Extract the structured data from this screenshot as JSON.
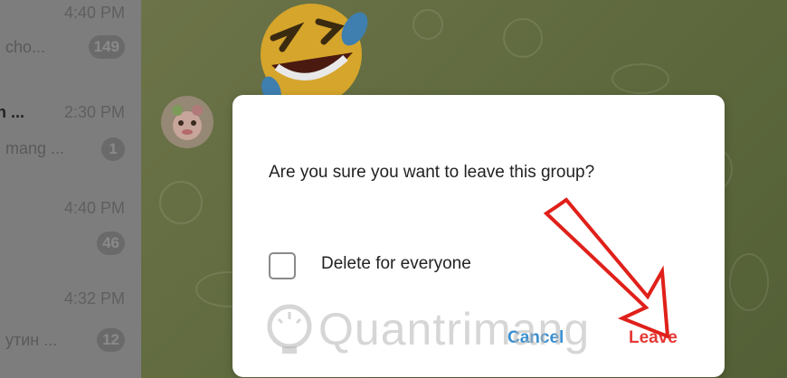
{
  "chat_list": [
    {
      "time": "4:40 PM",
      "name": "",
      "preview": "cho...",
      "badge": "149"
    },
    {
      "time": "2:30 PM",
      "name": "n ...",
      "preview": "mang ...",
      "badge": "1"
    },
    {
      "time": "4:40 PM",
      "name": "",
      "preview": "",
      "badge": "46"
    },
    {
      "time": "4:32 PM",
      "name": "",
      "preview": "утин ...",
      "badge": "12"
    }
  ],
  "dialog": {
    "message": "Are you sure you want to leave this group?",
    "checkbox_label": "Delete for everyone",
    "checkbox_checked": false,
    "cancel_label": "Cancel",
    "leave_label": "Leave"
  },
  "watermark": "Quantrimang",
  "colors": {
    "cancel": "#3a8fd0",
    "leave": "#e53935",
    "arrow": "#e0201a"
  },
  "icons": {
    "emoji": "laughing-tears-emoji",
    "avatar": "sticker-avatar",
    "arrow": "red-arrow-annotation"
  }
}
